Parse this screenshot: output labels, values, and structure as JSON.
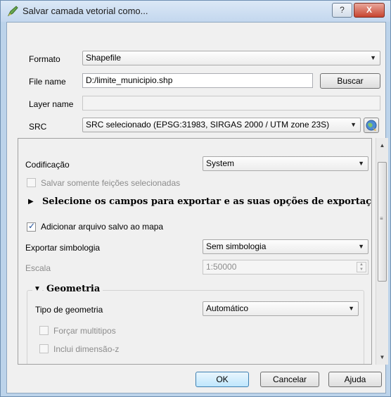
{
  "window": {
    "title": "Salvar camada vetorial como...",
    "help_label": "?",
    "close_label": "X"
  },
  "form": {
    "format_label": "Formato",
    "format_value": "Shapefile",
    "file_name_label": "File name",
    "file_name_value": "D:/limite_municipio.shp",
    "browse_label": "Buscar",
    "layer_name_label": "Layer name",
    "layer_name_value": "",
    "crs_label": "SRC",
    "crs_value": "SRC selecionado (EPSG:31983, SIRGAS 2000 / UTM zone 23S)"
  },
  "options": {
    "encoding_label": "Codificação",
    "encoding_value": "System",
    "save_selected_label": "Salvar somente feições selecionadas",
    "save_selected_checked": false,
    "select_fields_label": "Selecione os campos para exportar e as suas opções de exportação",
    "add_to_map_label": "Adicionar arquivo salvo ao mapa",
    "add_to_map_checked": true,
    "symbology_label": "Exportar simbologia",
    "symbology_value": "Sem simbologia",
    "scale_label": "Escala",
    "scale_value": "1:50000",
    "geometry_section_label": "Geometria",
    "geometry_type_label": "Tipo de geometria",
    "geometry_type_value": "Automático",
    "force_multi_label": "Forçar multitipos",
    "include_z_label": "Inclui dimensão-z"
  },
  "buttons": {
    "ok": "OK",
    "cancel": "Cancelar",
    "help": "Ajuda"
  },
  "icons": {
    "title": "qgis-pencil-icon",
    "crs": "globe-icon"
  }
}
